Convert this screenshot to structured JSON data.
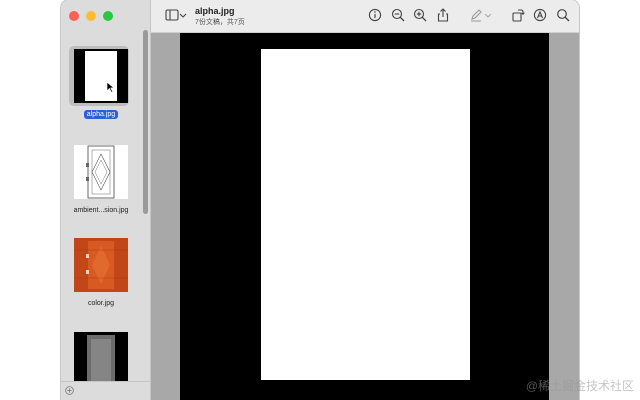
{
  "window": {
    "document_title": "alpha.jpg",
    "document_subtitle": "7份文稿，共7页"
  },
  "sidebar": {
    "items": [
      {
        "label": "alpha.jpg",
        "selected": true,
        "thumb": "white-page-on-black"
      },
      {
        "label": "ambient...sion.jpg",
        "selected": false,
        "thumb": "door-line-drawing"
      },
      {
        "label": "color.jpg",
        "selected": false,
        "thumb": "orange-door"
      },
      {
        "label": "",
        "selected": false,
        "thumb": "gray-door-on-black"
      }
    ]
  },
  "toolbar": {
    "icons": [
      "sidebar-toggle-icon",
      "chevron-down-icon",
      "info-icon",
      "zoom-out-icon",
      "zoom-in-icon",
      "share-icon",
      "markup-pen-icon",
      "chevron-down-icon",
      "rotate-icon",
      "annotate-icon",
      "search-icon"
    ]
  },
  "watermark": "@稀土掘金技术社区",
  "colors": {
    "selection": "#2a5fd8",
    "close": "#fe5f57",
    "minimize": "#febc2e",
    "zoom": "#28c840"
  }
}
